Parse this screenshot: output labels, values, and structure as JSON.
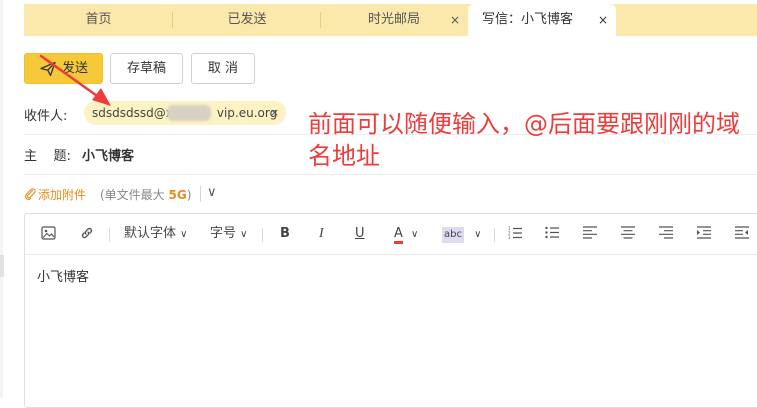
{
  "tabs": [
    {
      "label": "首页",
      "active": false,
      "closable": false
    },
    {
      "label": "已发送",
      "active": false,
      "closable": false
    },
    {
      "label": "时光邮局",
      "active": false,
      "closable": true
    },
    {
      "label": "写信：小飞博客",
      "active": true,
      "closable": true
    }
  ],
  "tab_close_glyph": "×",
  "actions": {
    "send": "发送",
    "draft": "存草稿",
    "cancel": "取 消"
  },
  "recipient": {
    "label": "收件人:",
    "addr_visible_start": "sdsdsdssd@x",
    "addr_visible_end": "vip.eu.org",
    "remove": "×"
  },
  "subject": {
    "label": "主    题:",
    "value": "小飞博客"
  },
  "attachment": {
    "add_label": "添加附件",
    "limit_prefix": "(单文件最大 ",
    "limit_size": "5G",
    "limit_suffix": ")",
    "toggle_glyph": "∨"
  },
  "toolbar": {
    "font_family": "默认字体",
    "font_size": "字号",
    "dropdown_glyph": "∨",
    "bold": "B",
    "italic": "I",
    "underline": "U",
    "font_color": "A",
    "highlight": "abc"
  },
  "editor_body": "小飞博客",
  "annotation": "前面可以随便输入，@后面要跟刚刚的域名地址",
  "colors": {
    "tab_bar": "#fbe9ab",
    "send_button": "#f6c93a",
    "chip": "#fcf2c3",
    "annotation": "#ee3c3c",
    "arrow": "#ee3c3c",
    "attach_link": "#e58d1f"
  }
}
